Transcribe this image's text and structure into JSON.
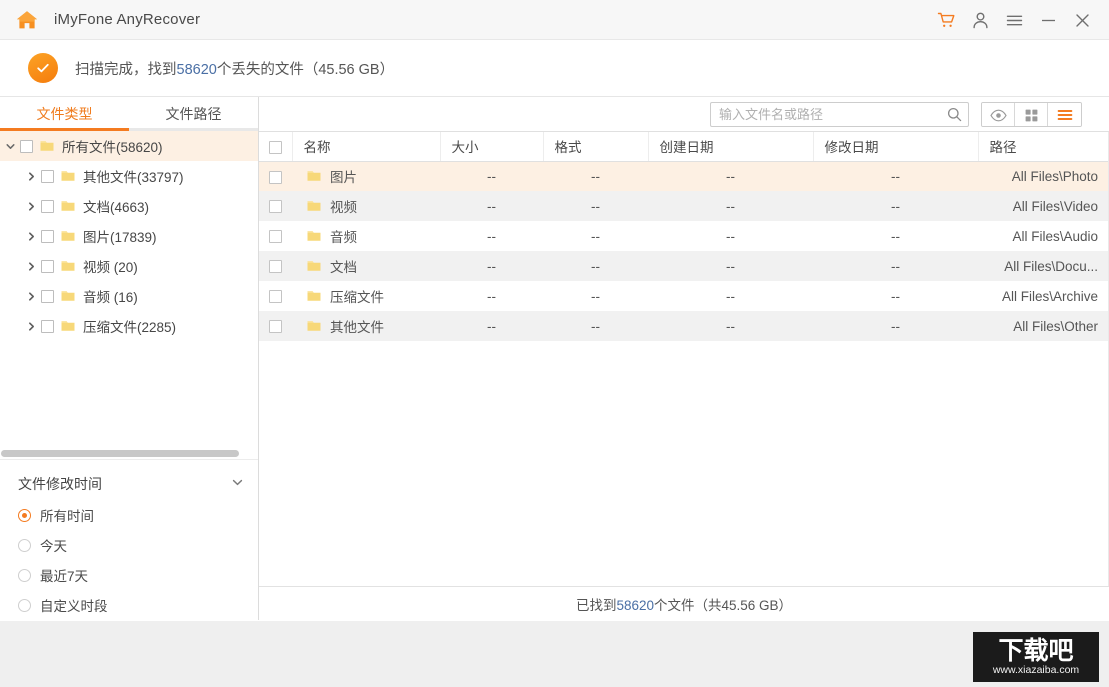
{
  "window": {
    "title": "iMyFone AnyRecover",
    "home_icon": "home-icon",
    "controls": {
      "cart": "cart-icon",
      "account": "person-icon",
      "menu": "hamburger-menu-icon",
      "minimize": "minimize-icon",
      "close": "close-icon"
    }
  },
  "status": {
    "icon": "check-circle-icon",
    "prefix": "扫描完成，找到",
    "count": "58620",
    "suffix": "个丢失的文件（45.56 GB）",
    "full_text": "扫描完成，找到58620个丢失的文件（45.56 GB）",
    "accent_color": "#f47b20"
  },
  "sidebar": {
    "tabs": [
      {
        "label": "文件类型",
        "active": true
      },
      {
        "label": "文件路径",
        "active": false
      }
    ],
    "tree": [
      {
        "label": "所有文件(58620)",
        "level": 0,
        "expanded": true,
        "selected": true,
        "checked": false
      },
      {
        "label": "其他文件(33797)",
        "level": 1,
        "expanded": false,
        "selected": false,
        "checked": false
      },
      {
        "label": "文档(4663)",
        "level": 1,
        "expanded": false,
        "selected": false,
        "checked": false
      },
      {
        "label": "图片(17839)",
        "level": 1,
        "expanded": false,
        "selected": false,
        "checked": false
      },
      {
        "label": "视频 (20)",
        "level": 1,
        "expanded": false,
        "selected": false,
        "checked": false
      },
      {
        "label": "音频 (16)",
        "level": 1,
        "expanded": false,
        "selected": false,
        "checked": false
      },
      {
        "label": "压缩文件(2285)",
        "level": 1,
        "expanded": false,
        "selected": false,
        "checked": false
      }
    ],
    "filter": {
      "title": "文件修改时间",
      "collapse_icon": "chevron-down-icon",
      "options": [
        {
          "label": "所有时间",
          "selected": true
        },
        {
          "label": "今天",
          "selected": false
        },
        {
          "label": "最近7天",
          "selected": false
        },
        {
          "label": "自定义时段",
          "selected": false
        }
      ]
    }
  },
  "toolbar": {
    "search": {
      "placeholder": "输入文件名或路径",
      "value": "",
      "icon": "search-icon"
    },
    "view_buttons": [
      {
        "name": "preview-eye-icon",
        "active": false
      },
      {
        "name": "grid-view-icon",
        "active": false
      },
      {
        "name": "list-view-icon",
        "active": true
      }
    ]
  },
  "table": {
    "select_all_checked": false,
    "columns": [
      "",
      "名称",
      "大小",
      "格式",
      "创建日期",
      "修改日期",
      "路径"
    ],
    "rows": [
      {
        "checked": false,
        "name": "图片",
        "size": "--",
        "format": "--",
        "created": "--",
        "modified": "--",
        "path": "All Files\\Photo"
      },
      {
        "checked": false,
        "name": "视频",
        "size": "--",
        "format": "--",
        "created": "--",
        "modified": "--",
        "path": "All Files\\Video"
      },
      {
        "checked": false,
        "name": "音频",
        "size": "--",
        "format": "--",
        "created": "--",
        "modified": "--",
        "path": "All Files\\Audio"
      },
      {
        "checked": false,
        "name": "文档",
        "size": "--",
        "format": "--",
        "created": "--",
        "modified": "--",
        "path": "All Files\\Docu..."
      },
      {
        "checked": false,
        "name": "压缩文件",
        "size": "--",
        "format": "--",
        "created": "--",
        "modified": "--",
        "path": "All Files\\Archive"
      },
      {
        "checked": false,
        "name": "其他文件",
        "size": "--",
        "format": "--",
        "created": "--",
        "modified": "--",
        "path": "All Files\\Other"
      }
    ]
  },
  "footer": {
    "prefix": "已找到",
    "count": "58620",
    "suffix": "个文件（共45.56 GB）",
    "full_text": "已找到58620个文件（共45.56 GB）"
  },
  "watermark": {
    "logo": "下载吧",
    "url": "www.xiazaiba.com"
  },
  "colors": {
    "accent": "#f47b20",
    "folder": "#f5d06a",
    "highlight_row": "#fdf0e3",
    "alt_row": "#f1f1f1",
    "number_text": "#4a6fa5"
  }
}
